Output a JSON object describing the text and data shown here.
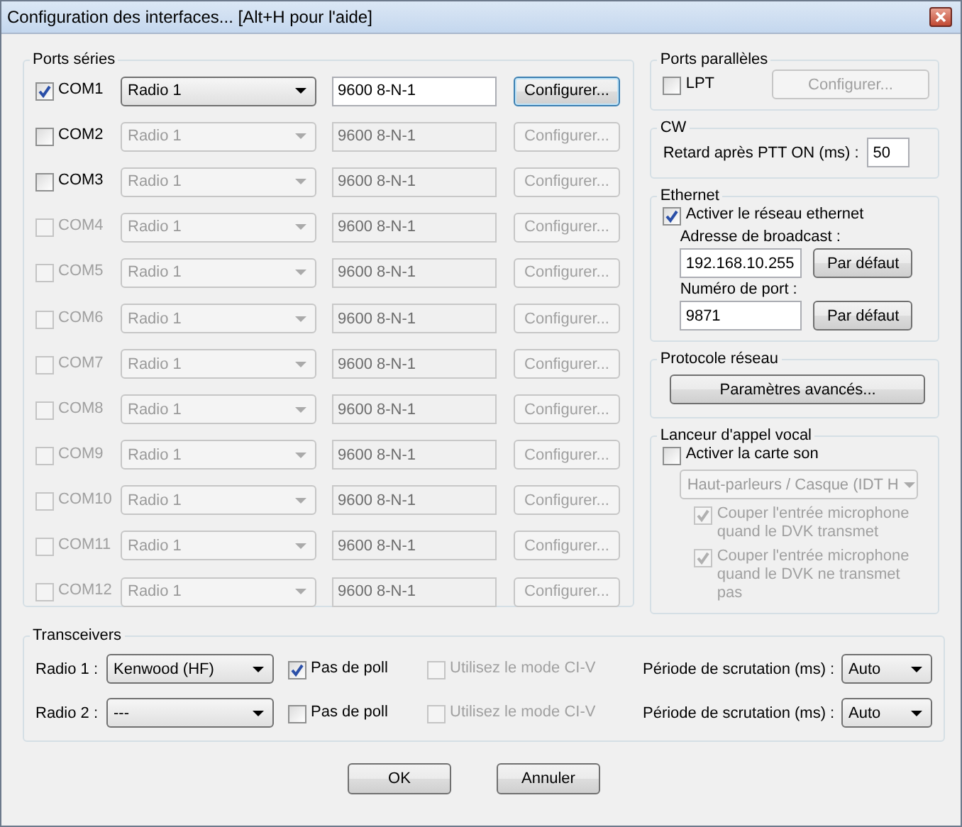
{
  "window": {
    "title": "Configuration des interfaces... [Alt+H pour l'aide]"
  },
  "serial_ports": {
    "title": "Ports séries",
    "ports": [
      {
        "name": "COM1",
        "checked": true,
        "disabled": false,
        "device": "Radio 1",
        "settings": "9600 8-N-1",
        "button": "Configurer...",
        "controls_disabled": false
      },
      {
        "name": "COM2",
        "checked": false,
        "disabled": false,
        "device": "Radio 1",
        "settings": "9600 8-N-1",
        "button": "Configurer...",
        "controls_disabled": true
      },
      {
        "name": "COM3",
        "checked": false,
        "disabled": false,
        "device": "Radio 1",
        "settings": "9600 8-N-1",
        "button": "Configurer...",
        "controls_disabled": true
      },
      {
        "name": "COM4",
        "checked": false,
        "disabled": true,
        "device": "Radio 1",
        "settings": "9600 8-N-1",
        "button": "Configurer...",
        "controls_disabled": true
      },
      {
        "name": "COM5",
        "checked": false,
        "disabled": true,
        "device": "Radio 1",
        "settings": "9600 8-N-1",
        "button": "Configurer...",
        "controls_disabled": true
      },
      {
        "name": "COM6",
        "checked": false,
        "disabled": true,
        "device": "Radio 1",
        "settings": "9600 8-N-1",
        "button": "Configurer...",
        "controls_disabled": true
      },
      {
        "name": "COM7",
        "checked": false,
        "disabled": true,
        "device": "Radio 1",
        "settings": "9600 8-N-1",
        "button": "Configurer...",
        "controls_disabled": true
      },
      {
        "name": "COM8",
        "checked": false,
        "disabled": true,
        "device": "Radio 1",
        "settings": "9600 8-N-1",
        "button": "Configurer...",
        "controls_disabled": true
      },
      {
        "name": "COM9",
        "checked": false,
        "disabled": true,
        "device": "Radio 1",
        "settings": "9600 8-N-1",
        "button": "Configurer...",
        "controls_disabled": true
      },
      {
        "name": "COM10",
        "checked": false,
        "disabled": true,
        "device": "Radio 1",
        "settings": "9600 8-N-1",
        "button": "Configurer...",
        "controls_disabled": true
      },
      {
        "name": "COM11",
        "checked": false,
        "disabled": true,
        "device": "Radio 1",
        "settings": "9600 8-N-1",
        "button": "Configurer...",
        "controls_disabled": true
      },
      {
        "name": "COM12",
        "checked": false,
        "disabled": true,
        "device": "Radio 1",
        "settings": "9600 8-N-1",
        "button": "Configurer...",
        "controls_disabled": true
      }
    ]
  },
  "parallel_ports": {
    "title": "Ports parallèles",
    "name": "LPT",
    "checked": false,
    "button": "Configurer...",
    "button_disabled": true
  },
  "cw": {
    "title": "CW",
    "label": "Retard après PTT ON (ms) :",
    "value": "50"
  },
  "ethernet": {
    "title": "Ethernet",
    "enable": {
      "label": "Activer le réseau ethernet",
      "checked": true
    },
    "fields": [
      {
        "label": "Adresse de broadcast :",
        "value": "192.168.10.255",
        "button": "Par défaut"
      },
      {
        "label": "Numéro de port :",
        "value": "9871",
        "button": "Par défaut"
      }
    ]
  },
  "network_protocol": {
    "title": "Protocole réseau",
    "button": "Paramètres avancés..."
  },
  "voice_keyer": {
    "title": "Lanceur d'appel vocal",
    "enable": {
      "label": "Activer la carte son",
      "checked": false
    },
    "device": "Haut-parleurs / Casque (IDT H",
    "options": [
      {
        "label": "Couper l'entrée microphone quand le DVK transmet",
        "checked": true,
        "disabled": true
      },
      {
        "label": "Couper l'entrée microphone quand le DVK ne transmet pas",
        "checked": true,
        "disabled": true
      }
    ]
  },
  "transceivers": {
    "title": "Transceivers",
    "radios": [
      {
        "label": "Radio 1 :",
        "model": "Kenwood (HF)",
        "no_poll": {
          "label": "Pas de poll",
          "checked": true
        },
        "civ": {
          "label": "Utilisez le mode CI-V",
          "checked": false,
          "disabled": true
        },
        "poll_label": "Période de scrutation (ms) :",
        "poll": "Auto"
      },
      {
        "label": "Radio 2 :",
        "model": "---",
        "no_poll": {
          "label": "Pas de poll",
          "checked": false
        },
        "civ": {
          "label": "Utilisez le mode CI-V",
          "checked": false,
          "disabled": true
        },
        "poll_label": "Période de scrutation (ms) :",
        "poll": "Auto"
      }
    ]
  },
  "buttons": [
    {
      "label": "OK"
    },
    {
      "label": "Annuler"
    }
  ]
}
